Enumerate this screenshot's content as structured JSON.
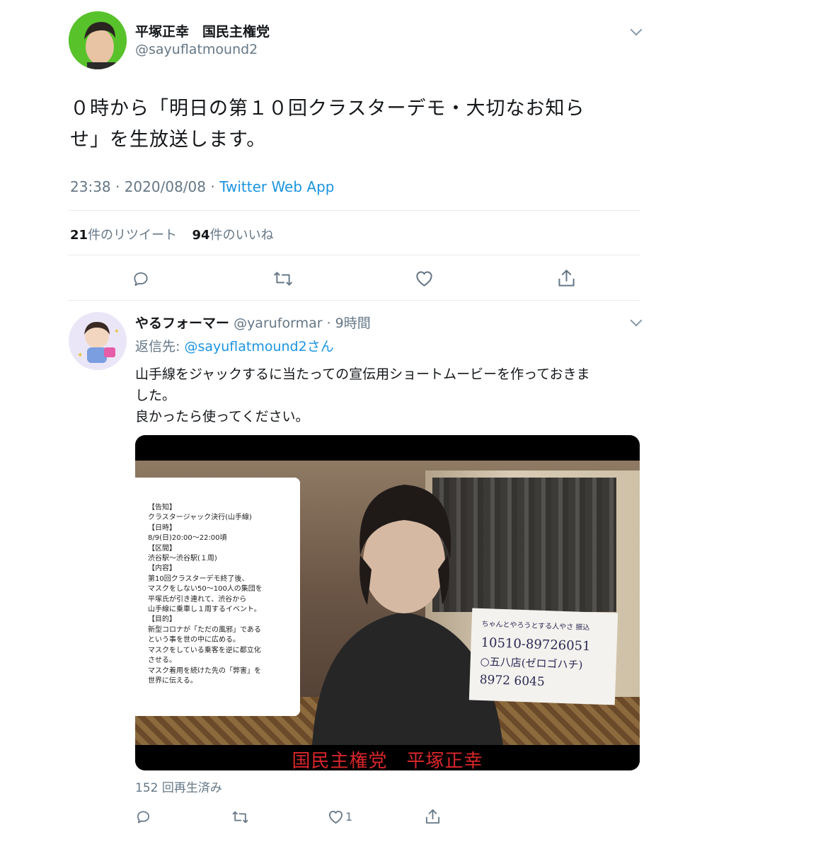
{
  "main_tweet": {
    "display_name": "平塚正幸　国民主権党",
    "handle": "@sayuflatmound2",
    "text_line1": "０時から「明日の第１０回クラスターデモ・大切なお知ら",
    "text_line2": "せ」を生放送します。",
    "time": "23:38 · 2020/08/08 · ",
    "source": "Twitter Web App",
    "retweet_count": "21",
    "retweet_label": "件のリツイート",
    "like_count": "94",
    "like_label": "件のいいね"
  },
  "reply": {
    "display_name": "やるフォーマー",
    "handle_time": "@yaruformar · 9時間",
    "reply_to_prefix": "返信先: ",
    "reply_to_handle": "@sayuflatmound2さん",
    "text_line1": "山手線をジャックするに当たっての宣伝用ショートムービーを作っておきま",
    "text_line2": "した。",
    "text_line3": "良かったら使ってください。",
    "video": {
      "notice_lines": [
        "【告知】",
        "クラスタージャック決行(山手線)",
        "【日時】",
        "8/9(日)20:00〜22:00頃",
        "【区間】",
        "渋谷駅〜渋谷駅(１周)",
        "【内容】",
        "第10回クラスターデモ終了後、",
        "マスクをしない50〜100人の集団を",
        "平塚氏が引き連れて、渋谷から",
        "山手線に乗車し１周するイベント。",
        "【目的】",
        "新型コロナが「ただの風邪」である",
        "という事を世の中に広める。",
        "マスクをしている乗客を逆に都立化",
        "させる。",
        "マスク着用を続けた先の「弊害」を",
        "世界に伝える。"
      ],
      "whiteboard_lines": [
        "ちゃんとやろうとする人やさ 振込",
        "10510-89726051",
        "○五八店(ゼロゴハチ)",
        "8972 6045"
      ],
      "caption": "国民主権党　平塚正幸"
    },
    "views": "152 回再生済み",
    "like_count": "1"
  },
  "colors": {
    "link": "#1b95e0",
    "muted": "#657786",
    "divider": "#e6ecf0",
    "caption_red": "#d9262b"
  }
}
